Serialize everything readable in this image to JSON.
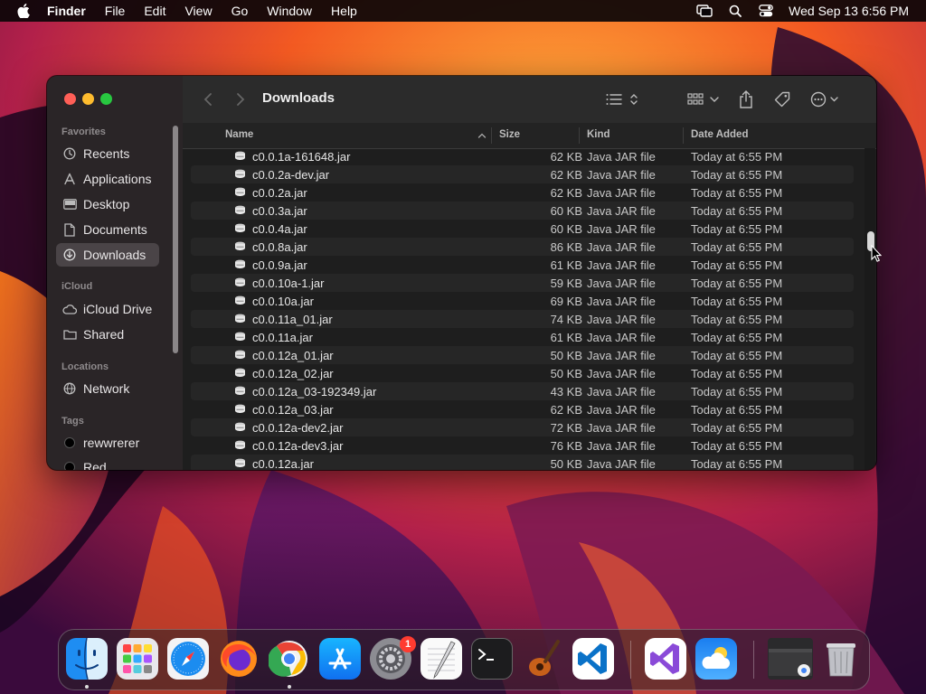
{
  "menubar": {
    "app_name": "Finder",
    "menus": [
      "File",
      "Edit",
      "View",
      "Go",
      "Window",
      "Help"
    ],
    "clock": "Wed Sep 13  6:56 PM"
  },
  "window": {
    "title": "Downloads",
    "sidebar": {
      "favorites_label": "Favorites",
      "favorites": [
        {
          "label": "Recents",
          "icon": "clock-icon"
        },
        {
          "label": "Applications",
          "icon": "applications-icon"
        },
        {
          "label": "Desktop",
          "icon": "desktop-icon"
        },
        {
          "label": "Documents",
          "icon": "document-icon"
        },
        {
          "label": "Downloads",
          "icon": "download-icon",
          "selected": true
        }
      ],
      "icloud_label": "iCloud",
      "icloud": [
        {
          "label": "iCloud Drive",
          "icon": "cloud-icon"
        },
        {
          "label": "Shared",
          "icon": "shared-folder-icon"
        }
      ],
      "locations_label": "Locations",
      "locations": [
        {
          "label": "Network",
          "icon": "network-icon"
        }
      ],
      "tags_label": "Tags",
      "tags": [
        {
          "label": "rewwrerer",
          "color": "#000000"
        },
        {
          "label": "Red",
          "color": "#000000"
        }
      ]
    },
    "columns": {
      "name": "Name",
      "size": "Size",
      "kind": "Kind",
      "date_added": "Date Added"
    },
    "files": [
      {
        "name": "c0.0.1a-161648.jar",
        "size": "62 KB",
        "kind": "Java JAR file",
        "date": "Today at 6:55 PM"
      },
      {
        "name": "c0.0.2a-dev.jar",
        "size": "62 KB",
        "kind": "Java JAR file",
        "date": "Today at 6:55 PM"
      },
      {
        "name": "c0.0.2a.jar",
        "size": "62 KB",
        "kind": "Java JAR file",
        "date": "Today at 6:55 PM"
      },
      {
        "name": "c0.0.3a.jar",
        "size": "60 KB",
        "kind": "Java JAR file",
        "date": "Today at 6:55 PM"
      },
      {
        "name": "c0.0.4a.jar",
        "size": "60 KB",
        "kind": "Java JAR file",
        "date": "Today at 6:55 PM"
      },
      {
        "name": "c0.0.8a.jar",
        "size": "86 KB",
        "kind": "Java JAR file",
        "date": "Today at 6:55 PM"
      },
      {
        "name": "c0.0.9a.jar",
        "size": "61 KB",
        "kind": "Java JAR file",
        "date": "Today at 6:55 PM"
      },
      {
        "name": "c0.0.10a-1.jar",
        "size": "59 KB",
        "kind": "Java JAR file",
        "date": "Today at 6:55 PM"
      },
      {
        "name": "c0.0.10a.jar",
        "size": "69 KB",
        "kind": "Java JAR file",
        "date": "Today at 6:55 PM"
      },
      {
        "name": "c0.0.11a_01.jar",
        "size": "74 KB",
        "kind": "Java JAR file",
        "date": "Today at 6:55 PM"
      },
      {
        "name": "c0.0.11a.jar",
        "size": "61 KB",
        "kind": "Java JAR file",
        "date": "Today at 6:55 PM"
      },
      {
        "name": "c0.0.12a_01.jar",
        "size": "50 KB",
        "kind": "Java JAR file",
        "date": "Today at 6:55 PM"
      },
      {
        "name": "c0.0.12a_02.jar",
        "size": "50 KB",
        "kind": "Java JAR file",
        "date": "Today at 6:55 PM"
      },
      {
        "name": "c0.0.12a_03-192349.jar",
        "size": "43 KB",
        "kind": "Java JAR file",
        "date": "Today at 6:55 PM"
      },
      {
        "name": "c0.0.12a_03.jar",
        "size": "62 KB",
        "kind": "Java JAR file",
        "date": "Today at 6:55 PM"
      },
      {
        "name": "c0.0.12a-dev2.jar",
        "size": "72 KB",
        "kind": "Java JAR file",
        "date": "Today at 6:55 PM"
      },
      {
        "name": "c0.0.12a-dev3.jar",
        "size": "76 KB",
        "kind": "Java JAR file",
        "date": "Today at 6:55 PM"
      },
      {
        "name": "c0.0.12a.jar",
        "size": "50 KB",
        "kind": "Java JAR file",
        "date": "Today at 6:55 PM"
      }
    ]
  },
  "dock": {
    "apps": [
      {
        "name": "finder-icon",
        "running": true
      },
      {
        "name": "launchpad-icon",
        "running": false
      },
      {
        "name": "safari-icon",
        "running": false
      },
      {
        "name": "firefox-icon",
        "running": false
      },
      {
        "name": "chrome-icon",
        "running": true
      },
      {
        "name": "app-store-icon",
        "running": false
      },
      {
        "name": "system-settings-icon",
        "running": false,
        "badge": "1"
      },
      {
        "name": "textedit-icon",
        "running": false
      },
      {
        "name": "terminal-icon",
        "running": false
      },
      {
        "name": "garageband-icon",
        "running": false
      },
      {
        "name": "vscode-icon",
        "running": false
      },
      {
        "name": "visual-studio-icon",
        "running": false
      },
      {
        "name": "weather-icon",
        "running": false
      },
      {
        "name": "chrome-window-thumbnail-icon",
        "running": false
      },
      {
        "name": "trash-icon",
        "running": false
      }
    ]
  },
  "colors": {
    "accent_close": "#ff5f57",
    "accent_min": "#febc2e",
    "accent_max": "#28c840",
    "badge": "#ff3b30"
  }
}
